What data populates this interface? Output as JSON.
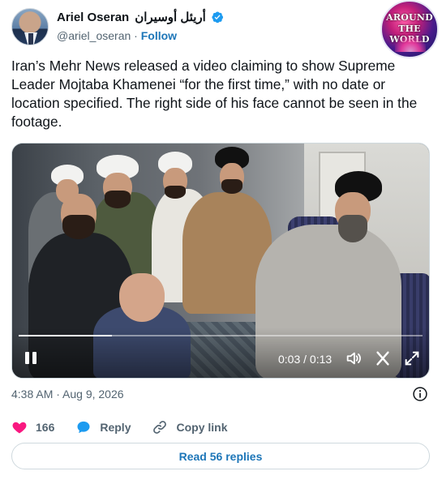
{
  "author": {
    "display_name": "Ariel Oseran",
    "arabic_name": "أريئل أوسيران",
    "handle": "@ariel_oseran",
    "separator": "·",
    "follow_label": "Follow"
  },
  "logo": {
    "line1": "AROUND",
    "line2": "THE WORLD"
  },
  "tweet": {
    "text": "Iran’s Mehr News released a video claiming to show Supreme Leader Mojtaba Khamenei “for the first time,” with no date or location specified. The right side of his face cannot be seen in the footage."
  },
  "video": {
    "time_readout": "0:03 / 0:13",
    "progress_fraction": 0.23,
    "icons": [
      "pause-icon",
      "volume-icon",
      "close-icon",
      "fullscreen-icon"
    ]
  },
  "meta": {
    "timestamp": "4:38 AM · Aug 9, 2026"
  },
  "actions": {
    "like_count": "166",
    "reply_label": "Reply",
    "copy_link_label": "Copy link"
  },
  "footer": {
    "read_replies_label": "Read 56 replies"
  },
  "colors": {
    "link": "#1d76b8",
    "like": "#f91880",
    "reply": "#1d9bf0",
    "muted": "#536471"
  }
}
